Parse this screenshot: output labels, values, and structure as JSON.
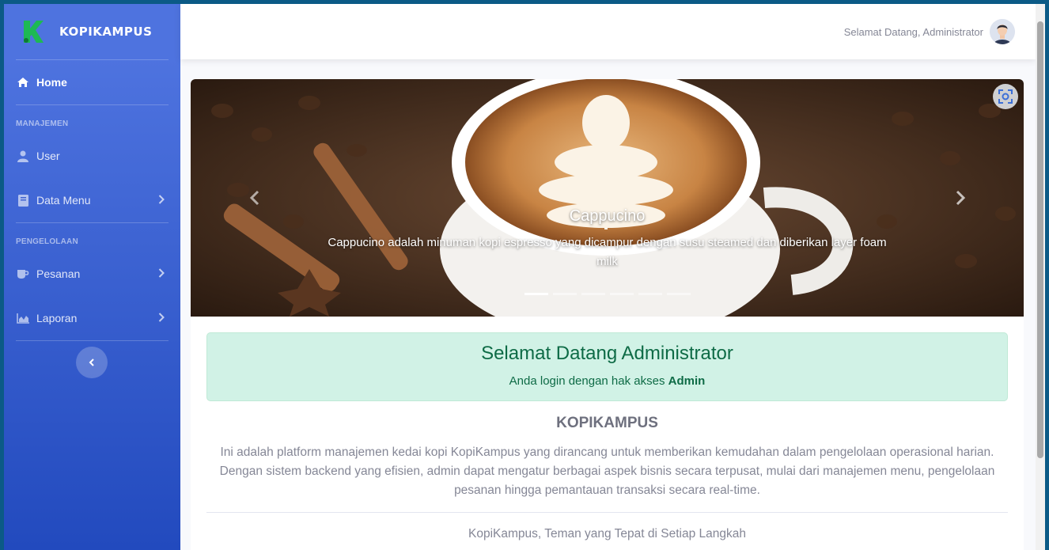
{
  "brand": {
    "name": "KOPIKAMPUS",
    "logo_icon": "k-logo-icon",
    "logo_color": "#1db954"
  },
  "sidebar": {
    "home": {
      "label": "Home",
      "icon": "home-icon"
    },
    "heading_manajemen": "MANAJEMEN",
    "user": {
      "label": "User",
      "icon": "user-icon"
    },
    "data_menu": {
      "label": "Data Menu",
      "icon": "book-icon"
    },
    "heading_pengelolaan": "PENGELOLAAN",
    "pesanan": {
      "label": "Pesanan",
      "icon": "coffee-icon"
    },
    "laporan": {
      "label": "Laporan",
      "icon": "chart-area-icon"
    }
  },
  "topbar": {
    "welcome": "Selamat Datang, Administrator"
  },
  "carousel": {
    "title": "Cappucino",
    "text": "Cappucino adalah minuman kopi espresso yang dicampur dengan susu steamed dan diberikan layer foam milk",
    "slide_count": 6,
    "active_index": 0
  },
  "alert": {
    "title": "Selamat Datang Administrator",
    "prefix": "Anda login dengan hak akses",
    "role": "Admin"
  },
  "about": {
    "title": "KOPIKAMPUS",
    "text": "Ini adalah platform manajemen kedai kopi KopiKampus yang dirancang untuk memberikan kemudahan dalam pengelolaan operasional harian. Dengan sistem backend yang efisien, admin dapat mengatur berbagai aspek bisnis secara terpusat, mulai dari manajemen menu, pengelolaan pesanan hingga pemantauan transaksi secara real-time.",
    "tagline": "KopiKampus, Teman yang Tepat di Setiap Langkah"
  },
  "colors": {
    "sidebar_start": "#4e73df",
    "sidebar_end": "#224abe",
    "alert_bg": "#d1f2e6",
    "alert_text": "#0e6b46"
  }
}
